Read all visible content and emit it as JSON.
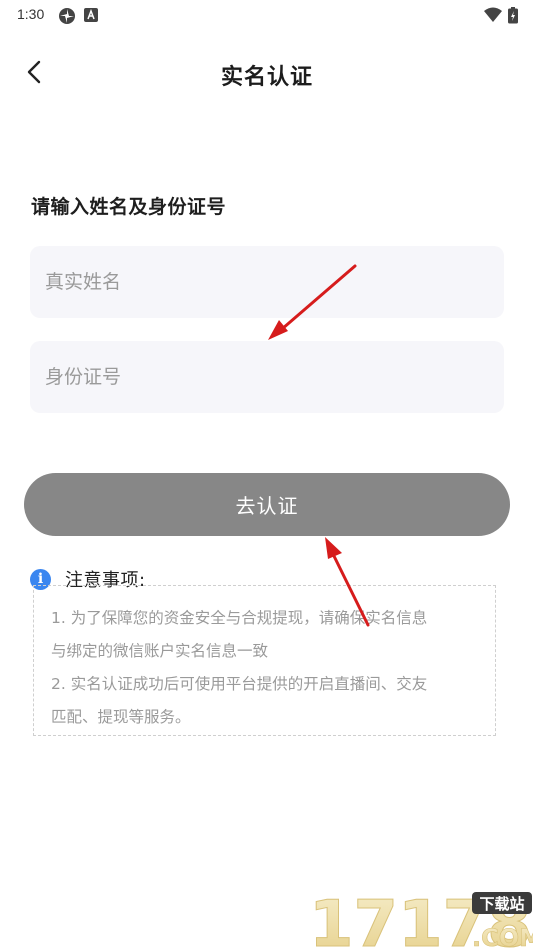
{
  "status_bar": {
    "time": "1:30"
  },
  "header": {
    "title": "实名认证"
  },
  "form": {
    "section_title": "请输入姓名及身份证号",
    "name_placeholder": "真实姓名",
    "id_placeholder": "身份证号",
    "submit_label": "去认证"
  },
  "notice": {
    "title": "注意事项:",
    "line1": "1. 为了保障您的资金安全与合规提现，请确保实名信息",
    "line2": "与绑定的微信账户实名信息一致",
    "line3": "2. 实名认证成功后可使用平台提供的开启直播间、交友",
    "line4": "匹配、提现等服务。"
  },
  "watermark": {
    "number": "17178",
    "badge": "下载站",
    "domain": ".COM"
  },
  "colors": {
    "button_bg": "#878787",
    "field_bg": "#f6f6fa",
    "info_accent": "#3a86f0",
    "annotation_arrow": "#d61c1c"
  }
}
